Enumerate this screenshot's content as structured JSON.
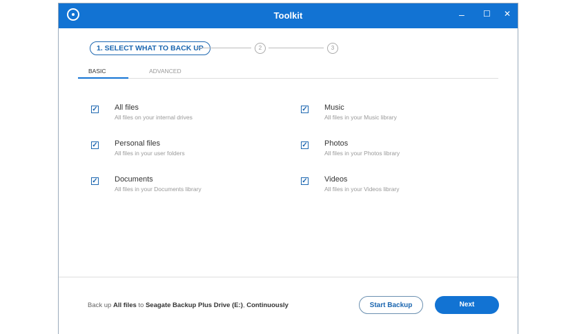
{
  "window": {
    "title": "Toolkit",
    "minimize": "–",
    "maximize": "☐",
    "close": "✕"
  },
  "steps": {
    "current": "1. SELECT WHAT TO BACK UP",
    "step2": "2",
    "step3": "3"
  },
  "tabs": [
    {
      "label": "BASIC",
      "active": true
    },
    {
      "label": "ADVANCED",
      "active": false
    }
  ],
  "items": [
    {
      "name": "All files",
      "desc": "All files on your internal drives",
      "checked": true
    },
    {
      "name": "Personal files",
      "desc": "All files in your user folders",
      "checked": true
    },
    {
      "name": "Documents",
      "desc": "All files in your Documents library",
      "checked": true
    },
    {
      "name": "Music",
      "desc": "All files in your Music library",
      "checked": true
    },
    {
      "name": "Photos",
      "desc": "All files in your Photos library",
      "checked": true
    },
    {
      "name": "Videos",
      "desc": "All files in your Videos library",
      "checked": true
    }
  ],
  "footer": {
    "p1": "Back up ",
    "what": "All files",
    "p2": " to ",
    "dest": "Seagate Backup Plus Drive (E:)",
    "p3": ", ",
    "freq": "Continuously",
    "start_backup": "Start Backup",
    "next": "Next"
  },
  "colors": {
    "accent": "#1273d3"
  }
}
